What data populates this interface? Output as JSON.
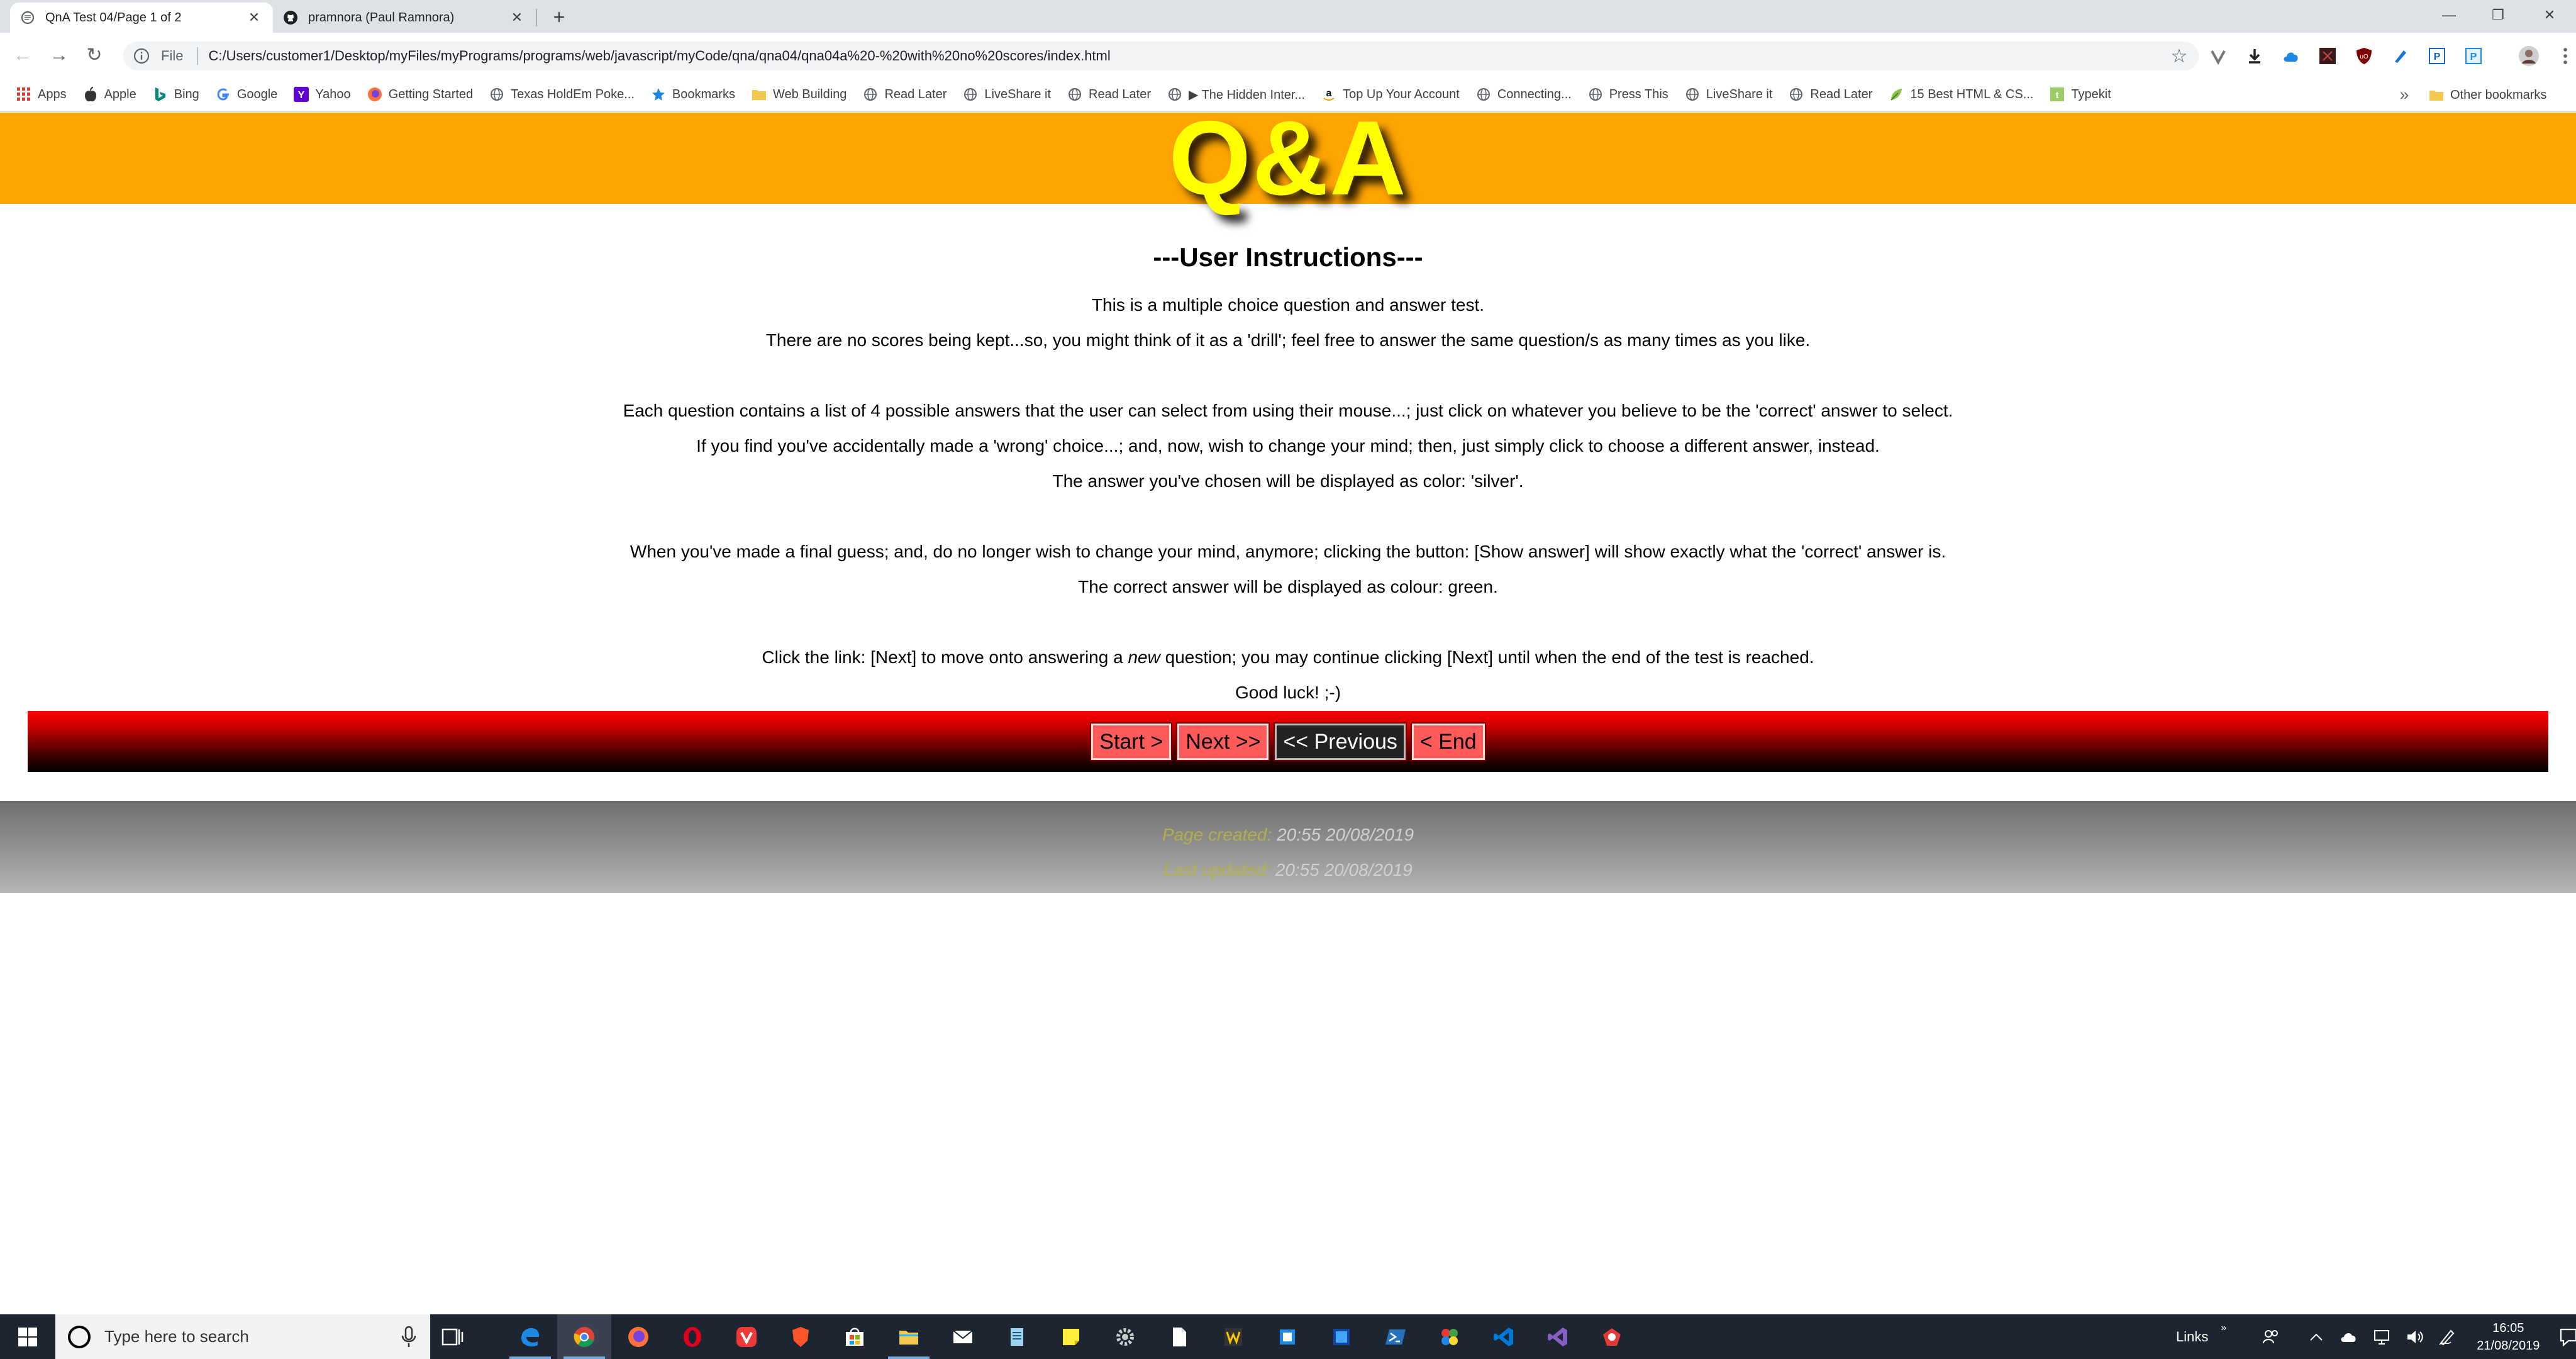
{
  "browser": {
    "tabs": [
      {
        "title": "QnA Test 04/Page 1 of 2",
        "active": true,
        "icon": "page-icon"
      },
      {
        "title": "pramnora (Paul Ramnora)",
        "active": false,
        "icon": "github-icon"
      }
    ],
    "address": {
      "scheme_label": "File",
      "url": "C:/Users/customer1/Desktop/myFiles/myPrograms/programs/web/javascript/myCode/qna/qna04/qna04a%20-%20with%20no%20scores/index.html"
    },
    "bookmarks": [
      {
        "label": "Apps",
        "icon": "apps-grid-icon"
      },
      {
        "label": "Apple",
        "icon": "apple-icon"
      },
      {
        "label": "Bing",
        "icon": "bing-icon"
      },
      {
        "label": "Google",
        "icon": "google-icon"
      },
      {
        "label": "Yahoo",
        "icon": "yahoo-icon"
      },
      {
        "label": "Getting Started",
        "icon": "firefox-icon"
      },
      {
        "label": "Texas HoldEm Poke...",
        "icon": "globe-icon"
      },
      {
        "label": "Bookmarks",
        "icon": "star-icon"
      },
      {
        "label": "Web Building",
        "icon": "folder-icon"
      },
      {
        "label": "Read Later",
        "icon": "globe-icon"
      },
      {
        "label": "LiveShare it",
        "icon": "globe-icon"
      },
      {
        "label": "Read Later",
        "icon": "globe-icon"
      },
      {
        "label": "▶ The Hidden Inter...",
        "icon": "globe-icon"
      },
      {
        "label": "Top Up Your Account",
        "icon": "amazon-icon"
      },
      {
        "label": "Connecting...",
        "icon": "globe-icon"
      },
      {
        "label": "Press This",
        "icon": "globe-icon"
      },
      {
        "label": "LiveShare it",
        "icon": "globe-icon"
      },
      {
        "label": "Read Later",
        "icon": "globe-icon"
      },
      {
        "label": "15 Best HTML & CS...",
        "icon": "leaf-icon"
      },
      {
        "label": "Typekit",
        "icon": "typekit-icon"
      }
    ],
    "bookmarks_more": "»",
    "other_bookmarks": "Other bookmarks"
  },
  "page": {
    "logo": "Q&A",
    "heading": "---User Instructions---",
    "instructions": {
      "p1": "This is a multiple choice question and answer test.",
      "p2": "There are no scores being kept...so, you might think of it as a 'drill'; feel free to answer the same question/s as many times as you like.",
      "p3": "Each question contains a list of 4 possible answers that the user can select from using their mouse...; just click on whatever you believe to be the 'correct' answer to select.",
      "p4": "If you find you've accidentally made a 'wrong' choice...; and, now, wish to change your mind; then, just simply click to choose a different answer, instead.",
      "p5": "The answer you've chosen will be displayed as color: 'silver'.",
      "p6": "When you've made a final guess; and, do no longer wish to change your mind, anymore; clicking the button: [Show answer] will show exactly what the 'correct' answer is.",
      "p7": "The correct answer will be displayed as colour: green.",
      "p8_before": "Click the link: [Next] to move onto answering a ",
      "p8_em": "new",
      "p8_after": " question; you may continue clicking [Next] until when the end of the test is reached.",
      "p9": "Good luck! ;-)"
    },
    "nav_buttons": {
      "start": "Start >",
      "next": "Next >>",
      "previous": "<< Previous",
      "end": "< End"
    },
    "footer": {
      "created_label": "Page created:",
      "created_value": "20:55 20/08/2019",
      "updated_label": "Last updated:",
      "updated_value": "20:55 20/08/2019"
    },
    "colors": {
      "banner": "#ffa500",
      "logo": "#ffff00",
      "navbar_top": "#ff0000",
      "navbar_bottom": "#000000"
    }
  },
  "taskbar": {
    "search_placeholder": "Type here to search",
    "apps": [
      "edge-icon",
      "chrome-icon",
      "firefox-icon",
      "opera-icon",
      "vivaldi-icon",
      "brave-icon",
      "store-icon",
      "file-explorer-icon",
      "mail-icon",
      "notepad-icon",
      "sticky-notes-icon",
      "settings-gear-icon",
      "document-icon",
      "winamp-icon",
      "app-blue-icon",
      "app-blue2-icon",
      "powershell-icon",
      "paint-icon",
      "vscode-icon",
      "visual-studio-icon",
      "app-red-icon"
    ],
    "tray_links": "Links",
    "tray_links_chevron": "»",
    "time": "16:05",
    "date": "21/08/2019"
  }
}
